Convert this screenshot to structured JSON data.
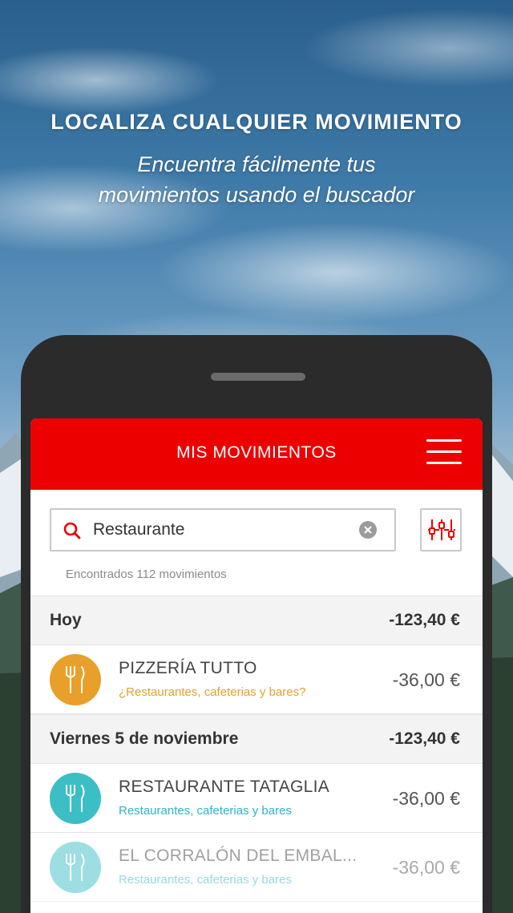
{
  "hero": {
    "title": "LOCALIZA CUALQUIER MOVIMIENTO",
    "subtitle_line1": "Encuentra fácilmente tus",
    "subtitle_line2": "movimientos usando el buscador"
  },
  "appbar": {
    "title": "MIS MOVIMIENTOS"
  },
  "search": {
    "value": "Restaurante"
  },
  "results": {
    "found_text": "Encontrados 112 movimientos"
  },
  "groups": [
    {
      "label": "Hoy",
      "amount": "-123,40 €",
      "movements": [
        {
          "name": "PIZZERÍA TUTTO",
          "category": "¿Restaurantes, cafeterias y bares?",
          "amount": "-36,00 €",
          "icon": "fork-knife-icon",
          "icon_color": "#e8a02a",
          "category_color": "#e8a02a"
        }
      ]
    },
    {
      "label": "Viernes 5 de noviembre",
      "amount": "-123,40 €",
      "movements": [
        {
          "name": "RESTAURANTE TATAGLIA",
          "category": "Restaurantes, cafeterias y bares",
          "amount": "-36,00 €",
          "icon": "fork-knife-icon",
          "icon_color": "#3cbfc4",
          "category_color": "#2fb4c8"
        },
        {
          "name": "EL CORRALÓN DEL EMBAL...",
          "category": "Restaurantes, cafeterias y bares",
          "amount": "-36,00 €",
          "icon": "fork-knife-icon",
          "icon_color": "#3cbfc4",
          "category_color": "#2fb4c8"
        }
      ]
    }
  ],
  "colors": {
    "brand_red": "#ec0000"
  }
}
